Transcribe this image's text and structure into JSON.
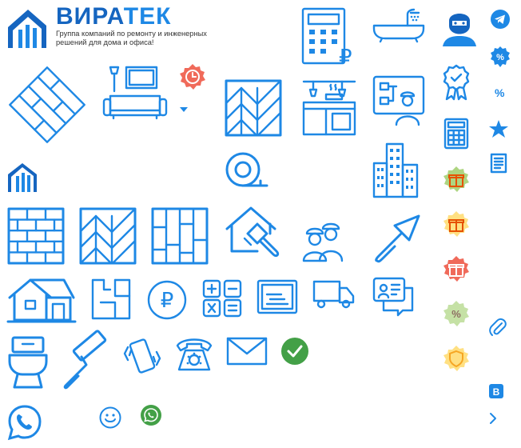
{
  "brand": {
    "name_part1": "ВИРА",
    "name_part2": "ТЕК",
    "tagline": "Группа компаний по ремонту и инженерных решений для дома и офиса!"
  },
  "icons": {
    "currency": "₽",
    "percent": "%"
  },
  "colors": {
    "primary": "#1e88e5",
    "dark_blue": "#1565c0",
    "green": "#43a047",
    "red_badge": "#f06a5a",
    "orange_badge": "#f6a623"
  }
}
